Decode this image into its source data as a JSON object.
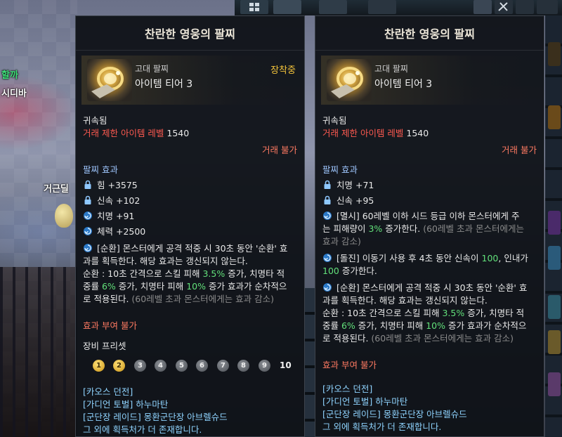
{
  "background": {
    "npc_labels": [
      "할까",
      "시디바",
      "거근딜"
    ]
  },
  "left_tooltip": {
    "title": "찬란한 영웅의 팔찌",
    "grade": "고대 팔찌",
    "tier": "아이템 티어 3",
    "equipped": "장착중",
    "bound": "귀속됨",
    "trade_level_label": "거래 제한 아이템 레벨",
    "trade_level_value": "1540",
    "trade_status": "거래 불가",
    "effects_header": "팔찌 효과",
    "stats": [
      {
        "icon": "lock-icon",
        "text": "힘 +3575"
      },
      {
        "icon": "lock-icon",
        "text": "신속 +102"
      },
      {
        "icon": "swirl-icon",
        "text": "치명 +91"
      },
      {
        "icon": "swirl-icon",
        "text": "체력 +2500"
      }
    ],
    "special": {
      "l1": "[순환] 몬스터에게 공격 적중 시 30초 동안 '순환' 효",
      "l2": "과를 획득한다. 해당 효과는 갱신되지 않는다.",
      "l3a": "순환 : 10초 간격으로 스킬 피해 ",
      "l3b": "3.5%",
      "l3c": " 증가, 치명타 적",
      "l4a": "중률 ",
      "l4b": "6%",
      "l4c": " 증가, 치명타 피해 ",
      "l4d": "10%",
      "l4e": " 증가 효과가 순차적으",
      "l5a": "로 적용된다.",
      "l5b": " (60레벨 초과 몬스터에게는 효과 감소)"
    },
    "grant_effect": "효과 부여 불가",
    "preset_label": "장비 프리셋",
    "preset_numbers": [
      "1",
      "2",
      "3",
      "4",
      "5",
      "6",
      "7",
      "8",
      "9",
      "10"
    ],
    "preset_active": [
      true,
      true,
      false,
      false,
      false,
      false,
      false,
      false,
      false,
      false
    ],
    "sources": [
      "[카오스 던전]",
      "[가디언 토벌] 하누마탄",
      "[군단장 레이드] 몽환군단장 아브렐슈드",
      "그 외에 획득처가 더 존재합니다."
    ]
  },
  "right_tooltip": {
    "title": "찬란한 영웅의 팔찌",
    "grade": "고대 팔찌",
    "tier": "아이템 티어 3",
    "bound": "귀속됨",
    "trade_level_label": "거래 제한 아이템 레벨",
    "trade_level_value": "1540",
    "trade_status": "거래 불가",
    "effects_header": "팔찌 효과",
    "stats": [
      {
        "icon": "lock-icon",
        "text": "치명 +71"
      },
      {
        "icon": "lock-icon",
        "text": "신속 +95"
      }
    ],
    "effect_a": {
      "l1": "[멸시] 60레벨 이하 시드 등급 이하 몬스터에게 주",
      "l2a": "는 피해량이 ",
      "l2b": "3%",
      "l2c": " 증가한다.",
      "l2d": " (60레벨 초과 몬스터에게는",
      "l3": "효과 감소)"
    },
    "effect_b": {
      "l1a": "[돌진] 이동기 사용 후 4초 동안 신속이 ",
      "l1b": "100",
      "l1c": ", 인내가",
      "l2a": "100",
      "l2b": " 증가한다."
    },
    "effect_c": {
      "l1": "[순환] 몬스터에게 공격 적중 시 30초 동안 '순환' 효",
      "l2": "과를 획득한다. 해당 효과는 갱신되지 않는다.",
      "l3a": "순환 : 10초 간격으로 스킬 피해 ",
      "l3b": "3.5%",
      "l3c": " 증가, 치명타 적",
      "l4a": "중률 ",
      "l4b": "6%",
      "l4c": " 증가, 치명타 피해 ",
      "l4d": "10%",
      "l4e": " 증가 효과가 순차적으",
      "l5a": "로 적용된다.",
      "l5b": " (60레벨 초과 몬스터에게는 효과 감소)"
    },
    "grant_effect": "효과 부여 불가",
    "sources": [
      "[카오스 던전]",
      "[가디언 토벌] 하누마탄",
      "[군단장 레이드] 몽환군단장 아브렐슈드",
      "그 외에 획득처가 더 존재합니다."
    ]
  }
}
